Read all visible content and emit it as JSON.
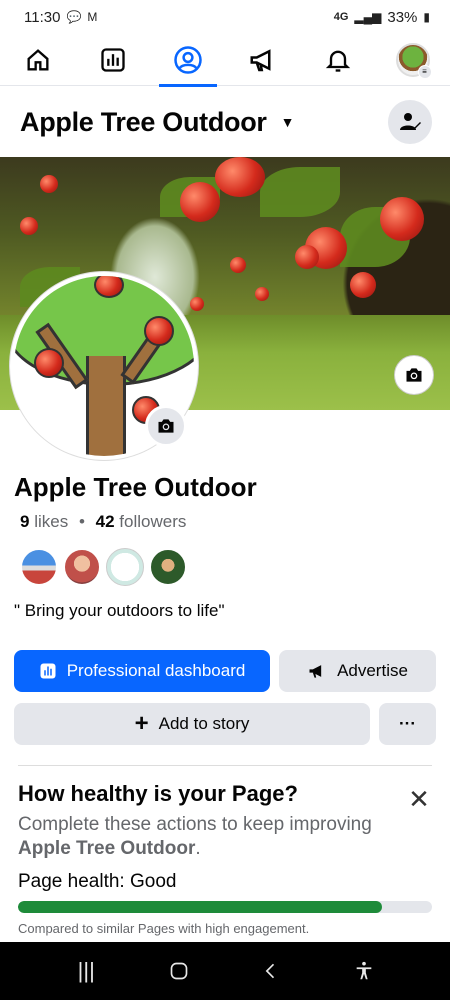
{
  "status_bar": {
    "time": "11:30",
    "network": "4G",
    "battery": "33%"
  },
  "top_nav": {
    "items": [
      {
        "icon": "home-icon"
      },
      {
        "icon": "dashboard-icon"
      },
      {
        "icon": "profile-icon",
        "active": true
      },
      {
        "icon": "megaphone-icon"
      },
      {
        "icon": "bell-icon"
      },
      {
        "icon": "avatar-menu-icon"
      }
    ]
  },
  "header": {
    "title": "Apple Tree Outdoor"
  },
  "profile": {
    "name": "Apple Tree Outdoor",
    "likes_count": "9",
    "likes_label": "likes",
    "followers_count": "42",
    "followers_label": "followers",
    "bio": "\" Bring your outdoors to life\""
  },
  "buttons": {
    "professional_dashboard": "Professional dashboard",
    "advertise": "Advertise",
    "add_to_story": "Add to story",
    "more": "···"
  },
  "health": {
    "title": "How healthy is your Page?",
    "desc_prefix": "Complete these actions to keep improving",
    "desc_page": "Apple Tree Outdoor",
    "desc_suffix": ".",
    "status_label": "Page health:",
    "status_value": "Good",
    "progress_percent": 88,
    "note": "Compared to similar Pages with high engagement."
  },
  "colors": {
    "accent": "#0866ff",
    "health_green": "#1e8b3a"
  }
}
